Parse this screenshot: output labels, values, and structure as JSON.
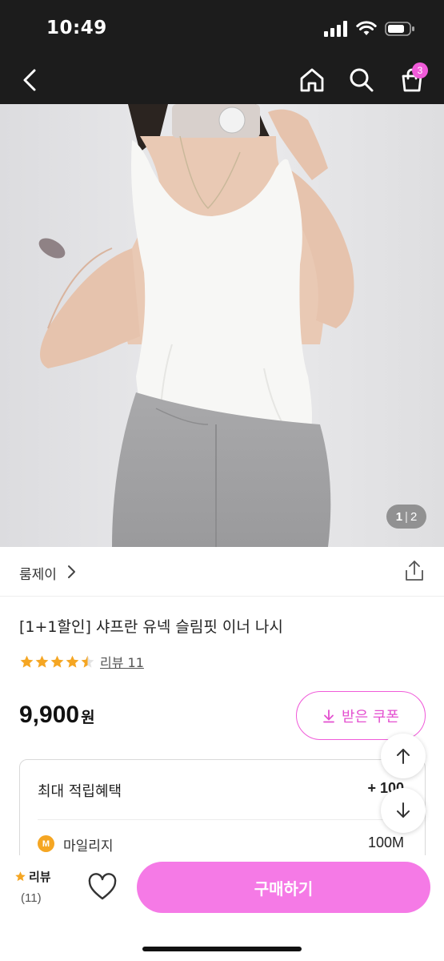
{
  "status_bar": {
    "time": "10:49"
  },
  "nav": {
    "back_icon": "chevron-left-icon",
    "home_icon": "home-icon",
    "search_icon": "search-icon",
    "cart_icon": "shopping-bag-icon",
    "cart_count": "3"
  },
  "gallery": {
    "current": "1",
    "separator": "|",
    "total": "2"
  },
  "brand": {
    "name": "룸제이",
    "share_icon": "share-icon"
  },
  "product": {
    "title": "[1+1할인] 샤프란 유넥 슬림핏 이너 나시",
    "rating": 4.5,
    "review_link": "리뷰 11",
    "price": "9,900",
    "price_unit": "원"
  },
  "coupon": {
    "label": "받은 쿠폰"
  },
  "benefits": {
    "title": "최대 적립혜택",
    "value": "+ 100",
    "mileage_badge": "M",
    "mileage_label": "마일리지",
    "mileage_value": "100M"
  },
  "bottom_bar": {
    "review_label": "리뷰",
    "review_count": "(11)",
    "buy_label": "구매하기"
  },
  "colors": {
    "accent": "#f57ae6",
    "accent_text": "#e44fd0",
    "star": "#f5a623",
    "header_bg": "#1c1c1c"
  }
}
